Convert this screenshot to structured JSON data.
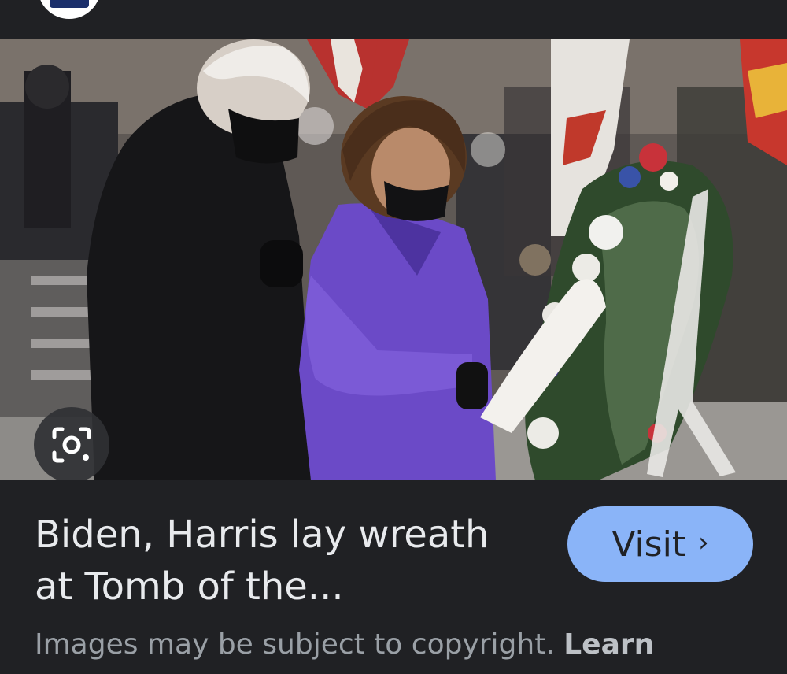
{
  "result": {
    "title": "Biden, Harris lay wreath at Tomb of the...",
    "visit_label": "Visit",
    "visit_chevron": "›"
  },
  "notice": {
    "text": "Images may be subject to copyright.",
    "learn_link": "Learn"
  },
  "icons": {
    "source_logo": "source-logo-icon",
    "lens": "lens-camera-icon",
    "chevron": "chevron-right-icon"
  },
  "colors": {
    "background": "#202124",
    "visit_button": "#8ab4f8",
    "title_text": "#e8eaed",
    "muted_text": "#9aa0a6"
  }
}
